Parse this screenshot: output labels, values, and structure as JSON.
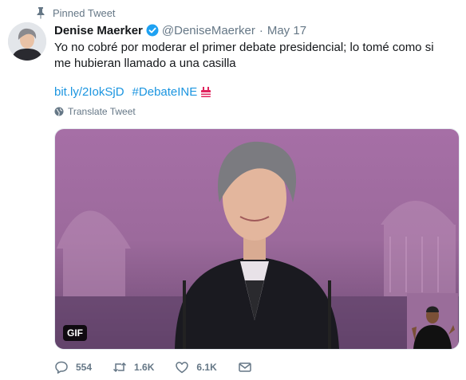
{
  "pinned": {
    "label": "Pinned Tweet"
  },
  "tweet": {
    "author_name": "Denise Maerker",
    "handle": "@DeniseMaerker",
    "separator": "·",
    "date": "May 17",
    "text": "Yo no cobré por moderar el primer debate presidencial; lo tomé como si me hubieran llamado a una casilla",
    "link": "bit.ly/2IokSjD",
    "hashtag": "#DebateINE",
    "translate_label": "Translate Tweet",
    "media_badge": "GIF"
  },
  "actions": {
    "replies": "554",
    "retweets": "1.6K",
    "likes": "6.1K"
  },
  "icons": [
    "pin-icon",
    "verified-icon",
    "hashtag-emoji-icon",
    "globe-icon",
    "reply-icon",
    "retweet-icon",
    "like-icon",
    "mail-icon"
  ],
  "colors": {
    "link": "#1b95e0",
    "muted": "#657786",
    "verified": "#1da1f2"
  }
}
